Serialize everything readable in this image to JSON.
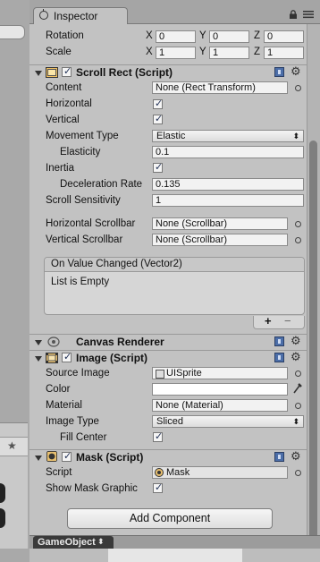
{
  "tab": {
    "label": "Inspector",
    "icon": "info-icon"
  },
  "transform": {
    "rotation": {
      "label": "Rotation",
      "x": "0",
      "y": "0",
      "z": "0"
    },
    "scale": {
      "label": "Scale",
      "x": "1",
      "y": "1",
      "z": "1"
    },
    "axis": {
      "x": "X",
      "y": "Y",
      "z": "Z"
    }
  },
  "scroll_rect": {
    "title": "Scroll Rect (Script)",
    "content": {
      "label": "Content",
      "value": "None (Rect Transform)"
    },
    "horizontal": {
      "label": "Horizontal",
      "checked": true
    },
    "vertical": {
      "label": "Vertical",
      "checked": true
    },
    "movement_type": {
      "label": "Movement Type",
      "value": "Elastic"
    },
    "elasticity": {
      "label": "Elasticity",
      "value": "0.1"
    },
    "inertia": {
      "label": "Inertia",
      "checked": true
    },
    "deceleration_rate": {
      "label": "Deceleration Rate",
      "value": "0.135"
    },
    "scroll_sensitivity": {
      "label": "Scroll Sensitivity",
      "value": "1"
    },
    "horizontal_scrollbar": {
      "label": "Horizontal Scrollbar",
      "value": "None (Scrollbar)"
    },
    "vertical_scrollbar": {
      "label": "Vertical Scrollbar",
      "value": "None (Scrollbar)"
    },
    "event": {
      "title": "On Value Changed (Vector2)",
      "empty": "List is Empty",
      "plus": "+",
      "minus": "−"
    }
  },
  "canvas_renderer": {
    "title": "Canvas Renderer"
  },
  "image": {
    "title": "Image (Script)",
    "source_image": {
      "label": "Source Image",
      "value": "UISprite"
    },
    "color": {
      "label": "Color",
      "value": "#ffffff"
    },
    "material": {
      "label": "Material",
      "value": "None (Material)"
    },
    "image_type": {
      "label": "Image Type",
      "value": "Sliced"
    },
    "fill_center": {
      "label": "Fill Center",
      "checked": true
    }
  },
  "mask": {
    "title": "Mask (Script)",
    "script": {
      "label": "Script",
      "value": "Mask"
    },
    "show_mask_graphic": {
      "label": "Show Mask Graphic",
      "checked": true
    }
  },
  "add_component": "Add Component",
  "bottom_tab": "GameObject",
  "colors": {
    "panel_bg": "#c2c2c2",
    "header_icon_blue": "#4c6ea8",
    "bottom_tab_bg": "#3a3a3a"
  }
}
